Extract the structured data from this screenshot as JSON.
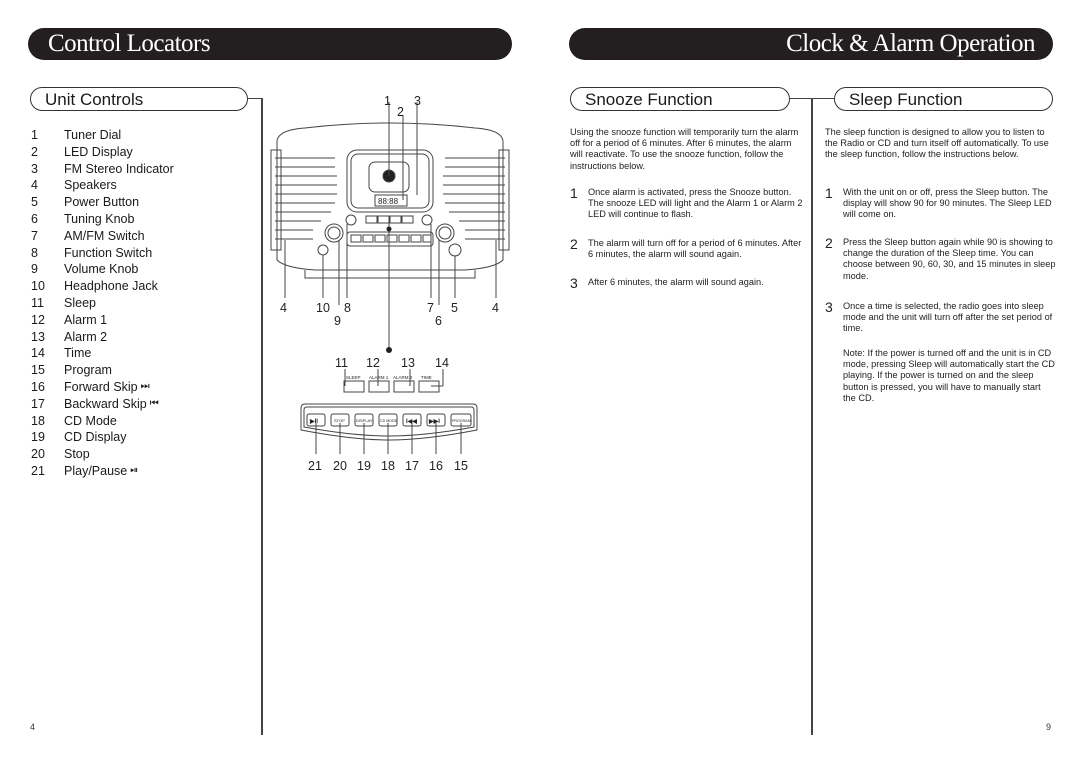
{
  "left_page": {
    "banner_title": "Control Locators",
    "section_title": "Unit Controls",
    "controls": [
      {
        "num": "1",
        "label": "Tuner Dial"
      },
      {
        "num": "2",
        "label": "LED Display"
      },
      {
        "num": "3",
        "label": "FM Stereo Indicator"
      },
      {
        "num": "4",
        "label": "Speakers"
      },
      {
        "num": "5",
        "label": "Power Button"
      },
      {
        "num": "6",
        "label": "Tuning Knob"
      },
      {
        "num": "7",
        "label": "AM/FM Switch"
      },
      {
        "num": "8",
        "label": "Function Switch"
      },
      {
        "num": "9",
        "label": "Volume Knob"
      },
      {
        "num": "10",
        "label": "Headphone Jack"
      },
      {
        "num": "11",
        "label": "Sleep"
      },
      {
        "num": "12",
        "label": "Alarm 1"
      },
      {
        "num": "13",
        "label": "Alarm 2"
      },
      {
        "num": "14",
        "label": "Time"
      },
      {
        "num": "15",
        "label": "Program"
      },
      {
        "num": "16",
        "label": "Forward Skip",
        "icon": "forward-skip-icon",
        "glyph": "⏭"
      },
      {
        "num": "17",
        "label": "Backward Skip",
        "icon": "backward-skip-icon",
        "glyph": "⏮"
      },
      {
        "num": "18",
        "label": "CD Mode"
      },
      {
        "num": "19",
        "label": "CD Display"
      },
      {
        "num": "20",
        "label": "Stop"
      },
      {
        "num": "21",
        "label": "Play/Pause",
        "icon": "play-pause-icon",
        "glyph": "⏯"
      }
    ],
    "diagram": {
      "top_callouts": [
        "1",
        "2",
        "3"
      ],
      "bottom_callouts_row1": [
        "4",
        "10",
        "8",
        "7",
        "5",
        "4"
      ],
      "bottom_callouts_row2": [
        "9",
        "6"
      ],
      "lcd_text": "88:88",
      "alarm_panel_callouts": [
        "11",
        "12",
        "13",
        "14"
      ],
      "alarm_panel_buttons": [
        "SLEEP",
        "ALARM 1",
        "ALARM 2",
        "TIME"
      ],
      "cd_panel_buttons": [
        "▶II",
        "STOP",
        "DISPLAY",
        "CD MODE",
        "I◀◀",
        "▶▶I",
        "PROGRAM"
      ],
      "cd_panel_callouts": [
        "21",
        "20",
        "19",
        "18",
        "17",
        "16",
        "15"
      ]
    },
    "page_number": "4"
  },
  "right_page": {
    "banner_title": "Clock & Alarm Operation",
    "snooze": {
      "title": "Snooze Function",
      "intro": "Using the snooze function will temporarily turn the alarm off for a period of 6 minutes. After 6 minutes, the alarm will reactivate.  To use the snooze function, follow the instructions below.",
      "steps": [
        {
          "num": "1",
          "text": "Once alarm is activated, press the Snooze button.  The snooze LED will light and the Alarm 1 or Alarm 2 LED will continue to flash."
        },
        {
          "num": "2",
          "text": "The alarm will turn off for a period of 6 minutes. After 6 minutes, the alarm will sound again."
        },
        {
          "num": "3",
          "text": "After 6 minutes, the alarm will sound again."
        }
      ]
    },
    "sleep": {
      "title": "Sleep Function",
      "intro": "The sleep function is designed to allow you to listen to the Radio or CD and turn itself off automatically.  To use the sleep function, follow the instructions below.",
      "steps": [
        {
          "num": "1",
          "text": "With the unit on or off, press the Sleep button. The display will show 90 for 90 minutes. The Sleep LED will come on."
        },
        {
          "num": "2",
          "text": "Press the Sleep button again while 90 is showing to change the duration of the Sleep time. You can choose between 90, 60, 30, and 15 minutes in sleep mode."
        },
        {
          "num": "3",
          "text": "Once a time is selected, the radio goes into sleep mode and the unit will turn off after the set period of time."
        }
      ],
      "note": "Note:  If the power is turned off and the unit is in CD mode, pressing Sleep will automatically start the CD playing.  If the power is turned on and the sleep button is pressed, you will have to manually start the CD."
    },
    "page_number": "9"
  }
}
